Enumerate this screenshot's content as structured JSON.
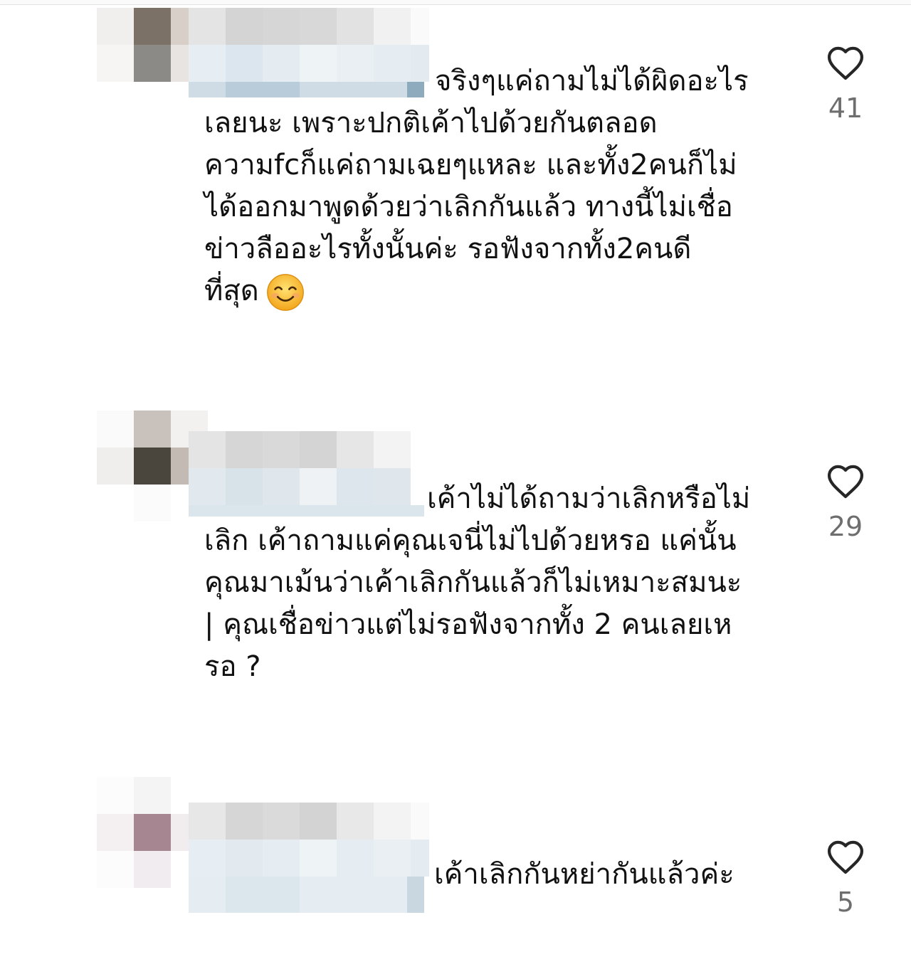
{
  "comments": [
    {
      "lines": [
        "จริงๆแค่ถามไม่ได้ผิดอะไร",
        "เลยนะ เพราะปกติเค้าไปด้วยกันตลอด",
        "ความfcก็แค่ถามเฉยๆแหละ และทั้ง2คนก็ไม่",
        "ได้ออกมาพูดด้วยว่าเลิกกันแล้ว ทางนี้ไม่เชื่อ",
        "ข่าวลืออะไรทั้งนั้นค่ะ รอฟังจากทั้ง2คนดี",
        "ที่สุด"
      ],
      "emoji": "smiling-face-emoji",
      "likes": "41"
    },
    {
      "lines": [
        "เค้าไม่ได้ถามว่าเลิกหรือไม่",
        "เลิก เค้าถามแค่คุณเจนี่ไม่ไปด้วยหรอ แค่นั้น",
        "คุณมาเม้นว่าเค้าเลิกกันแล้วก็ไม่เหมาะสมนะ",
        "| คุณเชื่อข่าวแต่ไม่รอฟังจากทั้ง 2 คนเลยเห",
        "รอ ?"
      ],
      "likes": "29"
    },
    {
      "lines": [
        "เค้าเลิกกันหย่ากันแล้วค่ะ"
      ],
      "likes": "5"
    }
  ],
  "colors": {
    "text": "#111111",
    "muted": "#6e6e6e",
    "heart_stroke": "#262626"
  },
  "icons": {
    "like": "heart-outline-icon"
  }
}
